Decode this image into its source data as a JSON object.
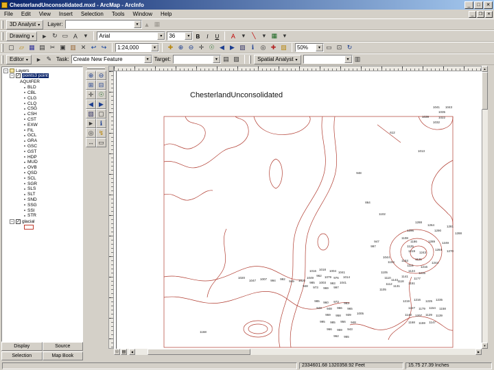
{
  "window": {
    "title": "ChesterlandUnconsolidated.mxd - ArcMap - ArcInfo",
    "buttons": [
      {
        "name": "minimize-button",
        "glyph": "_"
      },
      {
        "name": "maximize-button",
        "glyph": "□"
      },
      {
        "name": "close-button",
        "glyph": "✕"
      }
    ]
  },
  "mdi": {
    "buttons": [
      {
        "name": "mdi-minimize-button",
        "glyph": "_"
      },
      {
        "name": "mdi-restore-button",
        "glyph": "❐"
      },
      {
        "name": "mdi-close-button",
        "glyph": "✕"
      }
    ]
  },
  "menu": {
    "items": [
      "File",
      "Edit",
      "View",
      "Insert",
      "Selection",
      "Tools",
      "Window",
      "Help"
    ]
  },
  "toolbar_3d": {
    "menu_label": "3D Analyst",
    "layer_label": "Layer:",
    "layer_value": "",
    "icons": [
      {
        "name": "create-tin-icon",
        "glyph": "▲",
        "color": "#9a968e"
      },
      {
        "name": "interpolate-icon",
        "glyph": "▦",
        "color": "#9a968e"
      }
    ]
  },
  "toolbar_drawing": {
    "menu_label": "Drawing",
    "font": "Arial",
    "size": "36",
    "bold": "B",
    "italic": "I",
    "underline": "U",
    "icons_left": [
      {
        "name": "select-elements-icon",
        "glyph": "►",
        "color": "#333333"
      },
      {
        "name": "rotate-icon",
        "glyph": "↻",
        "color": "#333333"
      },
      {
        "name": "shape-tool-icon",
        "glyph": "▭",
        "color": "#333333"
      },
      {
        "name": "text-tool-icon",
        "glyph": "A",
        "color": "#333333"
      },
      {
        "name": "text-tool-dropdown-icon",
        "glyph": "▾",
        "color": "#333333"
      }
    ],
    "icons_right": [
      {
        "name": "font-color-icon",
        "glyph": "A",
        "color": "#c00000"
      },
      {
        "name": "font-color-dropdown-icon",
        "glyph": "▾",
        "color": "#333333"
      },
      {
        "name": "line-color-icon",
        "glyph": "╲",
        "color": "#c00000"
      },
      {
        "name": "line-color-dropdown-icon",
        "glyph": "▾",
        "color": "#333333"
      },
      {
        "name": "fill-color-icon",
        "glyph": "▦",
        "color": "#1a6620"
      },
      {
        "name": "fill-color-dropdown-icon",
        "glyph": "▾",
        "color": "#333333"
      }
    ]
  },
  "toolbar_standard": {
    "scale": "1:24,000",
    "zoom": "50%",
    "icons_left": [
      {
        "name": "new-map-icon",
        "glyph": "▢",
        "color": "#333333"
      },
      {
        "name": "open-icon",
        "glyph": "▱",
        "color": "#b8860b"
      },
      {
        "name": "save-icon",
        "glyph": "▦",
        "color": "#333399"
      },
      {
        "name": "print-icon",
        "glyph": "▤",
        "color": "#333333"
      },
      {
        "name": "cut-icon",
        "glyph": "✂",
        "color": "#333333"
      },
      {
        "name": "copy-icon",
        "glyph": "▣",
        "color": "#333333"
      },
      {
        "name": "paste-icon",
        "glyph": "▥",
        "color": "#996633"
      },
      {
        "name": "delete-icon",
        "glyph": "✕",
        "color": "#333333"
      },
      {
        "name": "undo-icon",
        "glyph": "↩",
        "color": "#003399"
      },
      {
        "name": "redo-icon",
        "glyph": "↪",
        "color": "#003399"
      }
    ],
    "icons_mid": [
      {
        "name": "add-data-icon",
        "glyph": "✚",
        "color": "#b8860b"
      },
      {
        "name": "zoom-in-icon",
        "glyph": "⊕",
        "color": "#1a3c8f"
      },
      {
        "name": "zoom-out-icon",
        "glyph": "⊖",
        "color": "#1a3c8f"
      },
      {
        "name": "pan-icon",
        "glyph": "✛",
        "color": "#333333"
      },
      {
        "name": "full-extent-icon",
        "glyph": "☉",
        "color": "#1a6620"
      },
      {
        "name": "back-extent-icon",
        "glyph": "◀",
        "color": "#1a3c8f"
      },
      {
        "name": "forward-extent-icon",
        "glyph": "▶",
        "color": "#1a3c8f"
      },
      {
        "name": "select-features-icon",
        "glyph": "▧",
        "color": "#333366"
      },
      {
        "name": "identify-icon",
        "glyph": "ℹ",
        "color": "#1a3c8f"
      },
      {
        "name": "find-icon",
        "glyph": "◎",
        "color": "#333333"
      },
      {
        "name": "arctoolbox-icon",
        "glyph": "✚",
        "color": "#b22222"
      },
      {
        "name": "arccatalog-icon",
        "glyph": "▨",
        "color": "#b8860b"
      }
    ],
    "icons_right": [
      {
        "name": "zoom-whole-page-icon",
        "glyph": "▭",
        "color": "#333333"
      },
      {
        "name": "zoom-100-icon",
        "glyph": "⊡",
        "color": "#333333"
      },
      {
        "name": "refresh-icon",
        "glyph": "↻",
        "color": "#1a3c8f"
      }
    ]
  },
  "toolbar_editor": {
    "menu_label": "Editor",
    "task_label": "Task:",
    "task_value": "Create New Feature",
    "target_label": "Target:",
    "target_value": "",
    "spatial_label": "Spatial Analyst",
    "layer_value": "",
    "icons_left": [
      {
        "name": "edit-arrow-icon",
        "glyph": "►",
        "color": "#333333"
      },
      {
        "name": "edit-sketch-icon",
        "glyph": "✎",
        "color": "#333333"
      }
    ],
    "icons_mid": [
      {
        "name": "attributes-icon",
        "glyph": "▤",
        "color": "#333333"
      },
      {
        "name": "sketch-properties-icon",
        "glyph": "▨",
        "color": "#333333"
      }
    ],
    "icons_right": [
      {
        "name": "histogram-icon",
        "glyph": "▥",
        "color": "#333333"
      }
    ]
  },
  "tools_vertical": {
    "buttons": [
      {
        "name": "zoom-in-icon",
        "glyph": "⊕",
        "color": "#1a3c8f"
      },
      {
        "name": "zoom-out-icon",
        "glyph": "⊖",
        "color": "#1a3c8f"
      },
      {
        "name": "fixed-zoom-in-icon",
        "glyph": "⊞",
        "color": "#1a3c8f"
      },
      {
        "name": "fixed-zoom-out-icon",
        "glyph": "⊟",
        "color": "#1a3c8f"
      },
      {
        "name": "pan-icon",
        "glyph": "✛",
        "color": "#333333"
      },
      {
        "name": "full-extent-icon",
        "glyph": "☉",
        "color": "#1a6620"
      },
      {
        "name": "back-extent-icon",
        "glyph": "◀",
        "color": "#1a3c8f"
      },
      {
        "name": "forward-extent-icon",
        "glyph": "▶",
        "color": "#1a3c8f"
      },
      {
        "name": "select-features-icon",
        "glyph": "▧",
        "color": "#333366"
      },
      {
        "name": "clear-selection-icon",
        "glyph": "▢",
        "color": "#333333"
      },
      {
        "name": "select-elements-icon",
        "glyph": "►",
        "color": "#333333"
      },
      {
        "name": "identify-icon",
        "glyph": "ℹ",
        "color": "#1a3c8f"
      },
      {
        "name": "find-icon",
        "glyph": "◎",
        "color": "#333333"
      },
      {
        "name": "hyperlink-icon",
        "glyph": "↯",
        "color": "#b8860b"
      },
      {
        "name": "measure-icon",
        "glyph": "↔",
        "color": "#333333"
      },
      {
        "name": "html-popup-icon",
        "glyph": "▭",
        "color": "#333333"
      }
    ]
  },
  "toc": {
    "root_label": "Layers",
    "layer_points": "points3 point",
    "legend_field": "AQUIFER",
    "sublayers": [
      "BLD",
      "CBL",
      "CLG",
      "CLQ",
      "CSG",
      "CSH",
      "CST",
      "EXW",
      "FIL",
      "GCL",
      "GRA",
      "GSC",
      "GST",
      "HDP",
      "MUD",
      "OVB",
      "QSD",
      "SCL",
      "SGR",
      "SLS",
      "SLT",
      "SND",
      "SSG",
      "SSI",
      "STR"
    ],
    "layer_glacial": "glacial",
    "tabs_row1": [
      "Display",
      "Source"
    ],
    "tabs_row2": [
      "Selection",
      "Map Book"
    ]
  },
  "map": {
    "title": "ChesterlandUnconsolidated",
    "labels": [
      [
        "1041",
        466,
        54
      ],
      [
        "1043",
        484,
        54
      ],
      [
        "1035",
        474,
        61
      ],
      [
        "1039",
        450,
        68
      ],
      [
        "1022",
        474,
        69
      ],
      [
        "1032",
        466,
        76
      ],
      [
        "612",
        402,
        91
      ],
      [
        "1013",
        444,
        118
      ],
      [
        "948",
        353,
        150
      ],
      [
        "864",
        366,
        193
      ],
      [
        "1102",
        387,
        210
      ],
      [
        "1288",
        440,
        222
      ],
      [
        "1264",
        458,
        226
      ],
      [
        "1296",
        428,
        234
      ],
      [
        "1290",
        468,
        234
      ],
      [
        "1281",
        486,
        228
      ],
      [
        "1288",
        498,
        238
      ],
      [
        "1108",
        420,
        245
      ],
      [
        "1186",
        433,
        250
      ],
      [
        "947",
        379,
        250
      ],
      [
        "997",
        374,
        257
      ],
      [
        "1125",
        428,
        257
      ],
      [
        "1289",
        459,
        250
      ],
      [
        "1249",
        479,
        252
      ],
      [
        "1219",
        430,
        264
      ],
      [
        "1243",
        446,
        266
      ],
      [
        "1284",
        469,
        262
      ],
      [
        "1270",
        486,
        264
      ],
      [
        "1044",
        393,
        273
      ],
      [
        "1104",
        400,
        280
      ],
      [
        "1153",
        420,
        278
      ],
      [
        "1121",
        440,
        276
      ],
      [
        "1114",
        428,
        285
      ],
      [
        "1216",
        448,
        287
      ],
      [
        "1244",
        464,
        281
      ],
      [
        "1124",
        430,
        293
      ],
      [
        "1216",
        445,
        296
      ],
      [
        "1141",
        420,
        301
      ],
      [
        "1177",
        438,
        304
      ],
      [
        "1118",
        414,
        308
      ],
      [
        "1151",
        430,
        311
      ],
      [
        "1105",
        390,
        295
      ],
      [
        "1110",
        395,
        303
      ],
      [
        "1143",
        405,
        306
      ],
      [
        "1112",
        397,
        312
      ],
      [
        "1131",
        408,
        315
      ],
      [
        "1105",
        388,
        320
      ],
      [
        "1016",
        286,
        293
      ],
      [
        "1018",
        300,
        291
      ],
      [
        "1004",
        315,
        293
      ],
      [
        "1041",
        328,
        295
      ],
      [
        "962",
        295,
        300
      ],
      [
        "1049",
        282,
        303
      ],
      [
        "1079",
        308,
        302
      ],
      [
        "976",
        320,
        303
      ],
      [
        "1014",
        335,
        302
      ],
      [
        "1020",
        270,
        307
      ],
      [
        "985",
        285,
        310
      ],
      [
        "1003",
        300,
        310
      ],
      [
        "993",
        315,
        311
      ],
      [
        "1041",
        330,
        310
      ],
      [
        "948",
        275,
        315
      ],
      [
        "973",
        290,
        317
      ],
      [
        "969",
        305,
        318
      ],
      [
        "997",
        320,
        317
      ],
      [
        "1020",
        182,
        303
      ],
      [
        "1047",
        198,
        307
      ],
      [
        "1007",
        214,
        305
      ],
      [
        "994",
        228,
        307
      ],
      [
        "992",
        242,
        305
      ],
      [
        "949",
        255,
        308
      ],
      [
        "985",
        292,
        337
      ],
      [
        "960",
        305,
        339
      ],
      [
        "973",
        320,
        338
      ],
      [
        "963",
        335,
        340
      ],
      [
        "943",
        295,
        347
      ],
      [
        "948",
        310,
        348
      ],
      [
        "966",
        325,
        347
      ],
      [
        "965",
        340,
        348
      ],
      [
        "959",
        308,
        357
      ],
      [
        "958",
        323,
        358
      ],
      [
        "939",
        338,
        357
      ],
      [
        "1005",
        355,
        355
      ],
      [
        "995",
        300,
        367
      ],
      [
        "985",
        315,
        368
      ],
      [
        "956",
        330,
        367
      ],
      [
        "948",
        345,
        368
      ],
      [
        "966",
        310,
        378
      ],
      [
        "959",
        325,
        379
      ],
      [
        "943",
        340,
        378
      ],
      [
        "962",
        320,
        388
      ],
      [
        "955",
        335,
        389
      ],
      [
        "1219",
        422,
        337
      ],
      [
        "1216",
        438,
        335
      ],
      [
        "1225",
        455,
        337
      ],
      [
        "1235",
        470,
        335
      ],
      [
        "1227",
        430,
        347
      ],
      [
        "1179",
        445,
        348
      ],
      [
        "1154",
        460,
        347
      ],
      [
        "1158",
        475,
        348
      ],
      [
        "1148",
        425,
        357
      ],
      [
        "1207",
        440,
        358
      ],
      [
        "1129",
        455,
        357
      ],
      [
        "1139",
        470,
        358
      ],
      [
        "1168",
        430,
        368
      ],
      [
        "1159",
        445,
        369
      ],
      [
        "1147",
        460,
        368
      ],
      [
        "1168",
        126,
        382
      ]
    ]
  },
  "status": {
    "left": "",
    "coords_feet": "2334601.68  1320358.92 Feet",
    "coords_inches": "15.75  27.39 Inches"
  },
  "colors": {
    "contour": "#b03a2e",
    "selection": "#0a246a",
    "titlebar_dark": "#0a246a",
    "titlebar_light": "#a6caf0"
  }
}
